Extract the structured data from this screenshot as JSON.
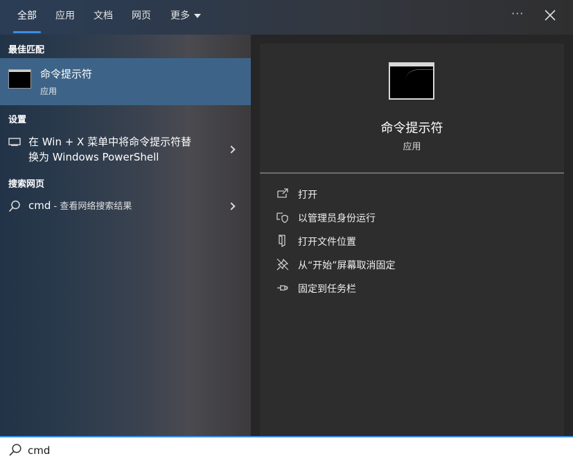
{
  "tabs": [
    {
      "label": "全部",
      "active": true
    },
    {
      "label": "应用",
      "active": false
    },
    {
      "label": "文档",
      "active": false
    },
    {
      "label": "网页",
      "active": false
    },
    {
      "label": "更多",
      "active": false
    }
  ],
  "window_controls": {
    "more_label": "···"
  },
  "sections": {
    "best_match": "最佳匹配",
    "settings": "设置",
    "web": "搜索网页"
  },
  "best_match_item": {
    "title": "命令提示符",
    "subtitle": "应用",
    "icon": "command-prompt-icon"
  },
  "settings_item": {
    "line1": "在 Win + X 菜单中将命令提示符替",
    "line2": "换为 Windows PowerShell",
    "icon": "display-icon"
  },
  "web_item": {
    "query": "cmd",
    "suffix": " - 查看网络搜索结果",
    "icon": "search-icon"
  },
  "detail": {
    "title": "命令提示符",
    "subtitle": "应用"
  },
  "actions": [
    {
      "label": "打开",
      "icon": "open-icon"
    },
    {
      "label": "以管理员身份运行",
      "icon": "shield-icon"
    },
    {
      "label": "打开文件位置",
      "icon": "folder-icon"
    },
    {
      "label": "从“开始”屏幕取消固定",
      "icon": "unpin-icon"
    },
    {
      "label": "固定到任务栏",
      "icon": "pin-icon"
    }
  ],
  "search": {
    "value": "cmd"
  },
  "colors": {
    "accent": "#3a8ee6",
    "selected_row": "#3d6488"
  }
}
